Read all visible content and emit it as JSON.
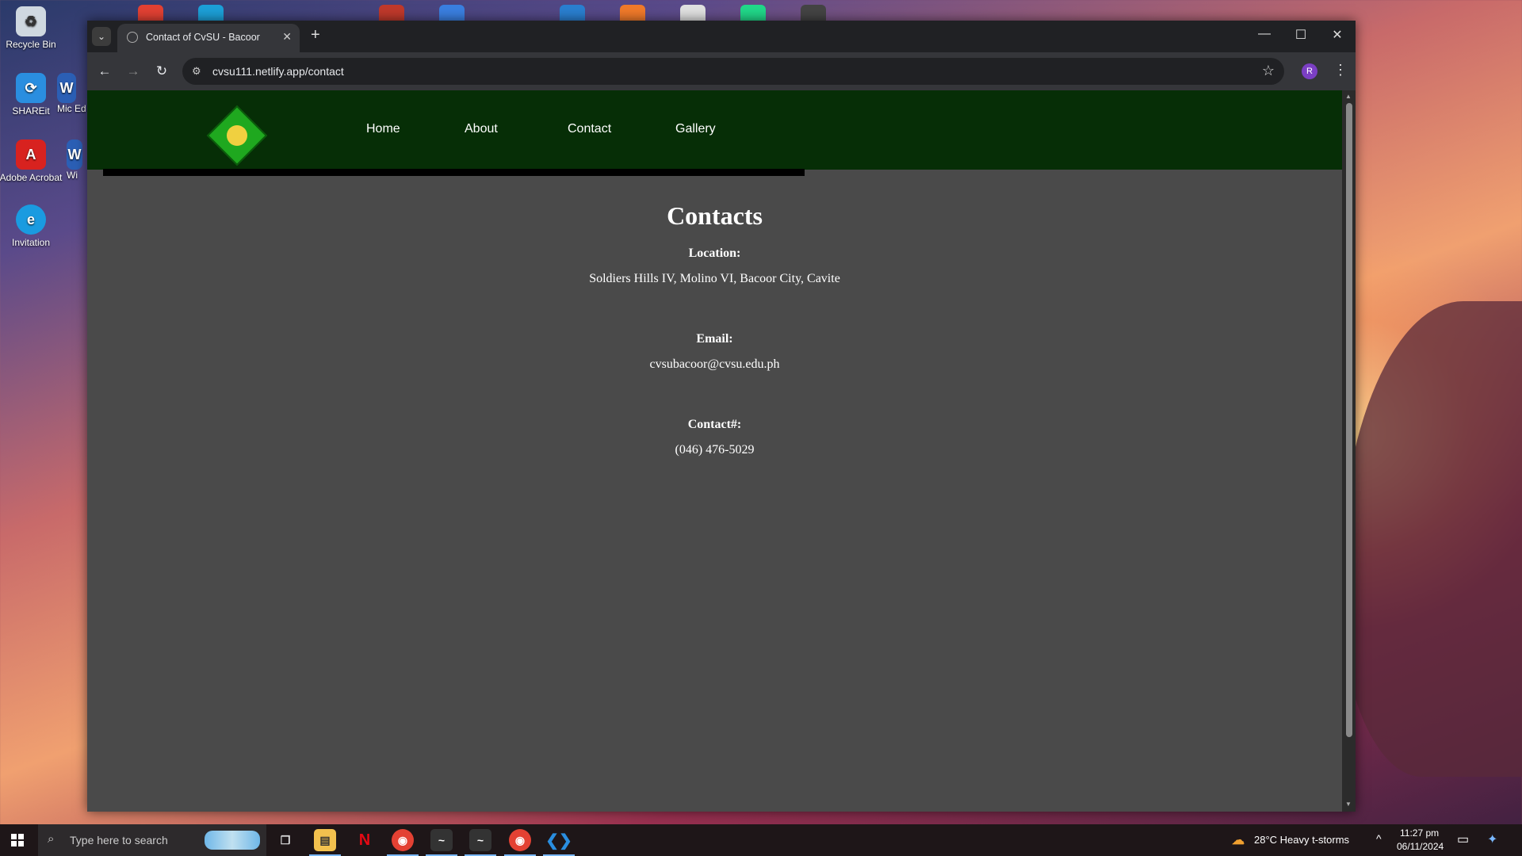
{
  "desktop": {
    "icons": [
      {
        "label": "Recycle Bin"
      },
      {
        "label": "SHAREit"
      },
      {
        "label": "Adobe Acrobat"
      },
      {
        "label": "Invitation"
      },
      {
        "label": "Mic Ed"
      },
      {
        "label": "Wi"
      }
    ]
  },
  "browser": {
    "tab_title": "Contact of CvSU - Bacoor",
    "url": "cvsu111.netlify.app/contact",
    "profile_initial": "R"
  },
  "site": {
    "nav": [
      "Home",
      "About",
      "Contact",
      "Gallery"
    ],
    "heading": "Contacts",
    "sections": [
      {
        "label": "Location:",
        "value": "Soldiers Hills IV, Molino VI, Bacoor City, Cavite"
      },
      {
        "label": "Email:",
        "value": "cvsubacoor@cvsu.edu.ph"
      },
      {
        "label": "Contact#:",
        "value": "(046) 476-5029"
      }
    ]
  },
  "taskbar": {
    "search_placeholder": "Type here to search",
    "weather": "28°C  Heavy t-storms",
    "time": "11:27 pm",
    "date": "06/11/2024"
  },
  "colors": {
    "site_header": "#062e06",
    "page_bg": "#4a4a4a",
    "browser_chrome": "#35363a"
  }
}
